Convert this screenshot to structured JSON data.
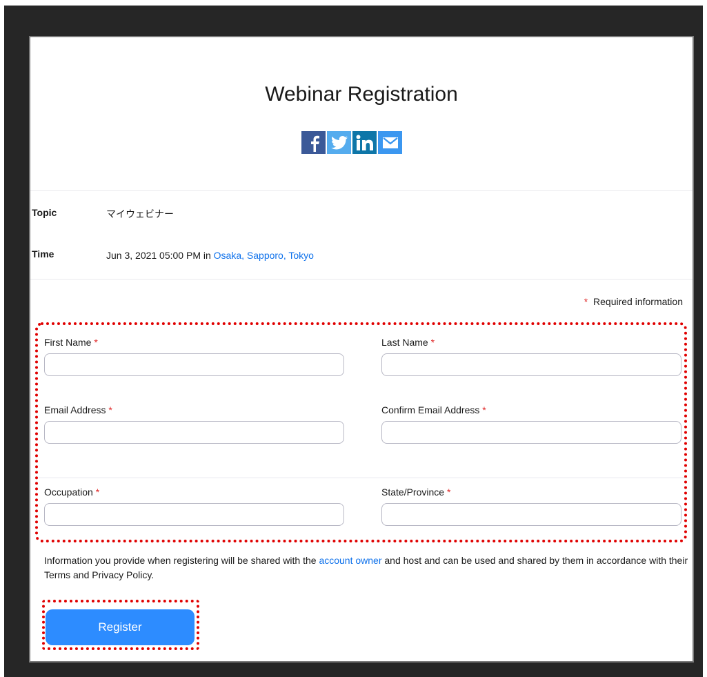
{
  "page": {
    "title": "Webinar Registration"
  },
  "share": {
    "icons": [
      "facebook-icon",
      "twitter-icon",
      "linkedin-icon",
      "email-icon"
    ]
  },
  "details": {
    "topic_label": "Topic",
    "topic_value": "マイウェビナー",
    "time_label": "Time",
    "time_value": "Jun 3, 2021 05:00 PM in ",
    "time_zone_link": "Osaka, Sapporo, Tokyo"
  },
  "form": {
    "required_star": "*",
    "required_note": "Required information",
    "first_name_label": "First Name",
    "last_name_label": "Last Name",
    "email_label": "Email Address",
    "confirm_email_label": "Confirm Email Address",
    "occupation_label": "Occupation",
    "state_label": "State/Province",
    "first_name_value": "",
    "last_name_value": "",
    "email_value": "",
    "confirm_email_value": "",
    "occupation_value": "",
    "state_value": ""
  },
  "notice": {
    "text_before": "Information you provide when registering will be shared with the ",
    "link": "account owner",
    "text_after": " and host and can be used and shared by them in accordance with their Terms and Privacy Policy."
  },
  "actions": {
    "register_label": "Register"
  },
  "colors": {
    "accent": "#2d8cff",
    "link": "#0e71eb",
    "required": "#e02828",
    "highlight": "#e00000"
  }
}
